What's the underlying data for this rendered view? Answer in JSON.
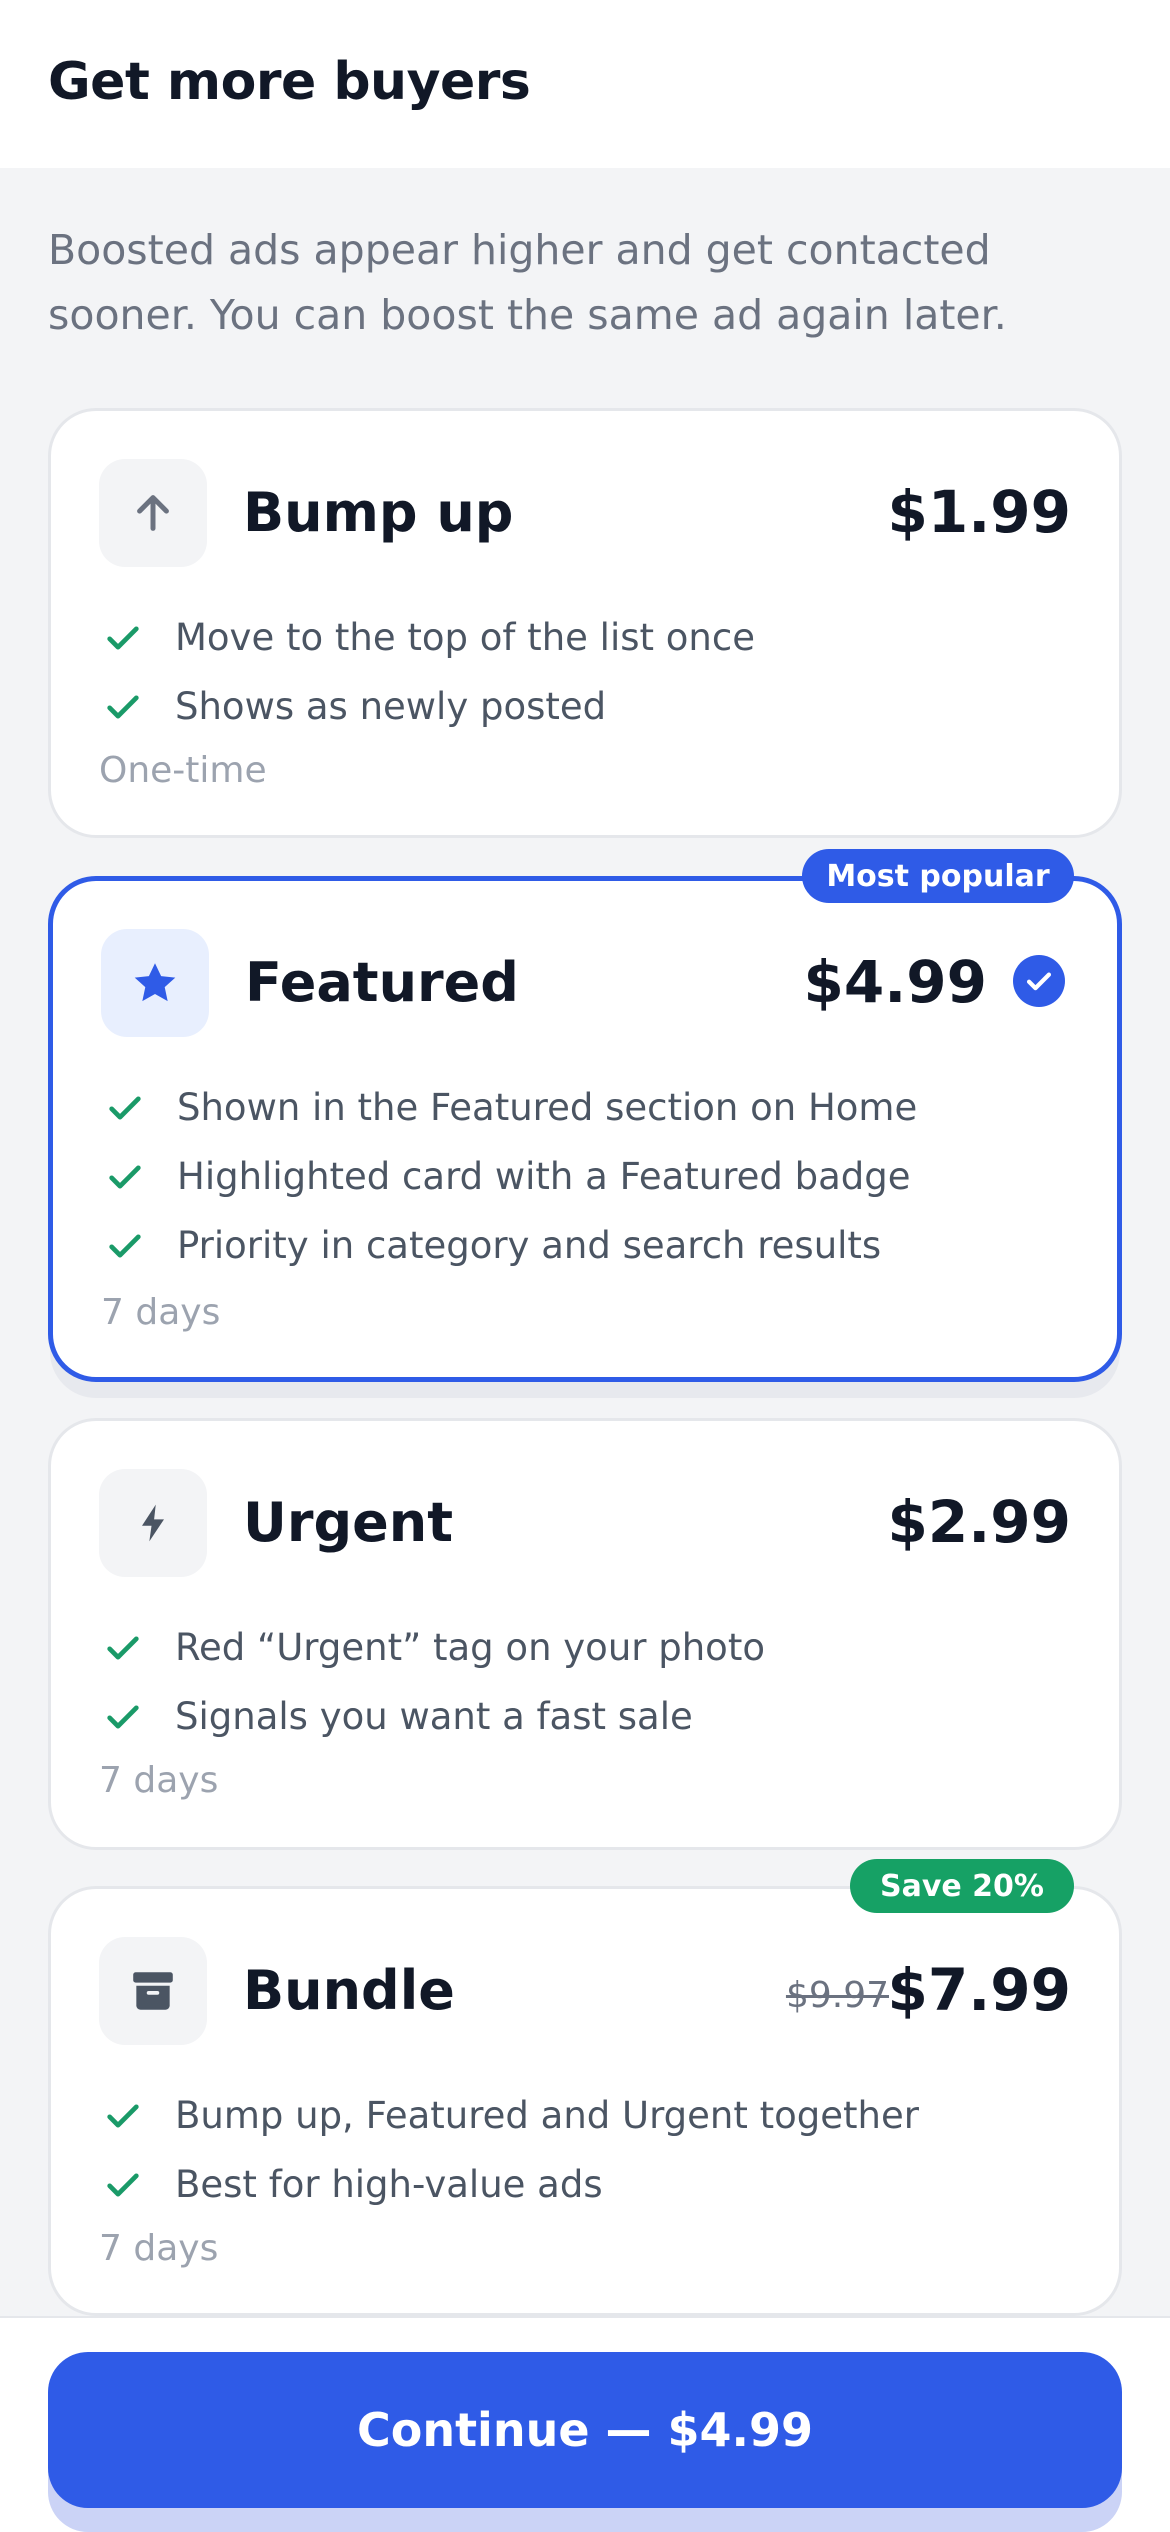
{
  "header": {
    "title": "Get more buyers"
  },
  "intro": "Boosted ads appear higher and get contacted sooner. You can boost the same ad again later.",
  "options": [
    {
      "title": "Bump up",
      "price": "$1.99",
      "icon": "arrow-up-icon",
      "features": [
        "Move to the top of the list once",
        "Shows as newly posted"
      ],
      "duration": "One-time"
    },
    {
      "title": "Featured",
      "price": "$4.99",
      "icon": "star-icon",
      "badge": "Most popular",
      "selected": true,
      "features": [
        "Shown in the Featured section on Home",
        "Highlighted card with a Featured badge",
        "Priority in category and search results"
      ],
      "duration": "7 days"
    },
    {
      "title": "Urgent",
      "price": "$2.99",
      "icon": "bolt-icon",
      "features": [
        "Red “Urgent” tag on your photo",
        "Signals you want a fast sale"
      ],
      "duration": "7 days"
    },
    {
      "title": "Bundle",
      "price": "$7.99",
      "old_price": "$9.97",
      "icon": "archive-box-icon",
      "badge": "Save 20%",
      "features": [
        "Bump up, Featured and Urgent together",
        "Best for high-value ads"
      ],
      "duration": "7 days"
    }
  ],
  "cta": {
    "label": "Continue — $4.99"
  },
  "colors": {
    "accent": "#2f5be7",
    "success": "#16a165",
    "check": "#1a9a68",
    "text_primary": "#111827",
    "text_secondary": "#6b7280",
    "background": "#f3f4f6"
  }
}
